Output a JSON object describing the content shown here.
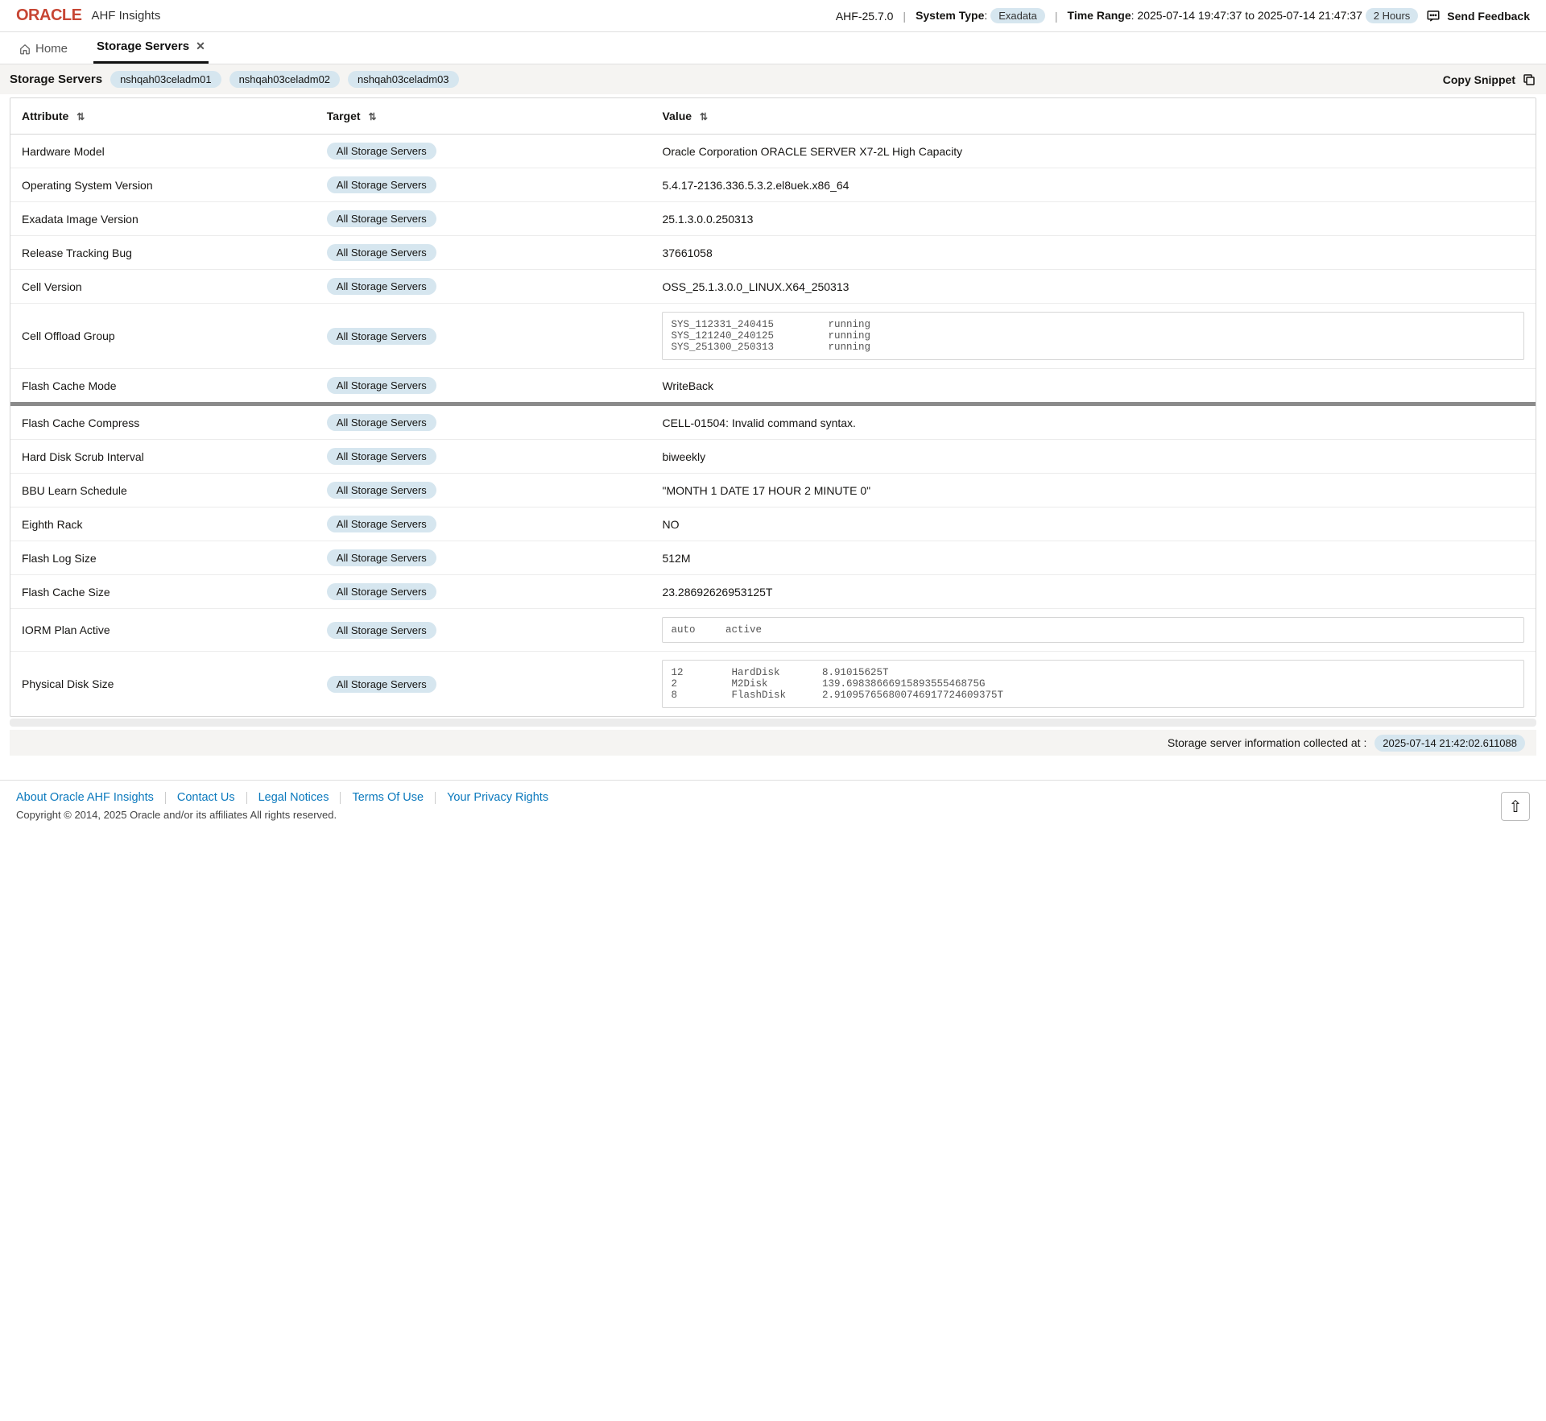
{
  "header": {
    "brand": "ORACLE",
    "app": "AHF Insights",
    "version": "AHF-25.7.0",
    "system_type_label": "System Type",
    "system_type": "Exadata",
    "time_range_label": "Time Range",
    "time_range": "2025-07-14 19:47:37 to 2025-07-14 21:47:37",
    "time_window": "2 Hours",
    "feedback": "Send Feedback"
  },
  "nav": {
    "home": "Home",
    "tab": "Storage Servers"
  },
  "subheader": {
    "title": "Storage Servers",
    "nodes": [
      "nshqah03celadm01",
      "nshqah03celadm02",
      "nshqah03celadm03"
    ],
    "copy": "Copy Snippet"
  },
  "columns": {
    "attribute": "Attribute",
    "target": "Target",
    "value": "Value"
  },
  "target_label": "All Storage Servers",
  "rows_top": [
    {
      "attr": "Hardware Model",
      "value": "Oracle Corporation ORACLE SERVER X7-2L High Capacity",
      "pre": false
    },
    {
      "attr": "Operating System Version",
      "value": "5.4.17-2136.336.5.3.2.el8uek.x86_64",
      "pre": false
    },
    {
      "attr": "Exadata Image Version",
      "value": "25.1.3.0.0.250313",
      "pre": false
    },
    {
      "attr": "Release Tracking Bug",
      "value": "37661058",
      "pre": false
    },
    {
      "attr": "Cell Version",
      "value": "OSS_25.1.3.0.0_LINUX.X64_250313",
      "pre": false
    },
    {
      "attr": "Cell Offload Group",
      "value": "SYS_112331_240415         running\nSYS_121240_240125         running\nSYS_251300_250313         running",
      "pre": true
    },
    {
      "attr": "Flash Cache Mode",
      "value": "WriteBack",
      "pre": false
    }
  ],
  "rows_bottom": [
    {
      "attr": "Flash Cache Compress",
      "value": "CELL-01504: Invalid command syntax.",
      "pre": false
    },
    {
      "attr": "Hard Disk Scrub Interval",
      "value": "biweekly",
      "pre": false
    },
    {
      "attr": "BBU Learn Schedule",
      "value": "\"MONTH 1 DATE 17 HOUR 2 MINUTE 0\"",
      "pre": false
    },
    {
      "attr": "Eighth Rack",
      "value": "NO",
      "pre": false
    },
    {
      "attr": "Flash Log Size",
      "value": "512M",
      "pre": false
    },
    {
      "attr": "Flash Cache Size",
      "value": "23.28692626953125T",
      "pre": false
    },
    {
      "attr": "IORM Plan Active",
      "value": "auto     active",
      "pre": true
    },
    {
      "attr": "Physical Disk Size",
      "value": "12        HardDisk       8.91015625T\n2         M2Disk         139.6983866691589355546875G\n8         FlashDisk      2.910957656800746917724609375T",
      "pre": true
    }
  ],
  "collected": {
    "label": "Storage server information collected at :",
    "ts": "2025-07-14 21:42:02.611088"
  },
  "footer": {
    "links": [
      "About Oracle AHF Insights",
      "Contact Us",
      "Legal Notices",
      "Terms Of Use",
      "Your Privacy Rights"
    ],
    "copyright": "Copyright © 2014, 2025 Oracle and/or its affiliates All rights reserved."
  }
}
